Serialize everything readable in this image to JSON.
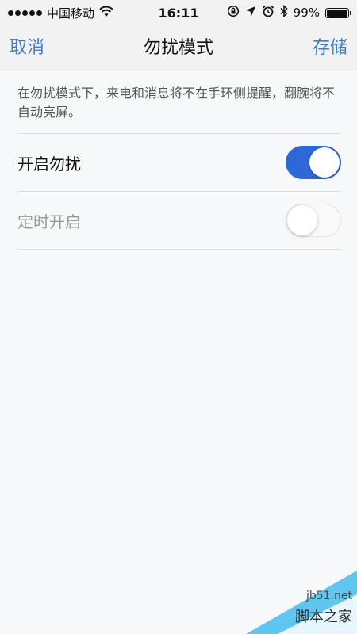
{
  "status_bar": {
    "carrier": "中国移动",
    "time": "16:11",
    "battery_text": "99%",
    "battery_level": 0.99,
    "icons": [
      "signal-dots-icon",
      "wifi-icon",
      "rotation-lock-icon",
      "location-arrow-icon",
      "alarm-icon",
      "bluetooth-icon",
      "battery-icon"
    ]
  },
  "nav": {
    "cancel_label": "取消",
    "title": "勿扰模式",
    "save_label": "存储"
  },
  "description": "在勿扰模式下，来电和消息将不在手环侧提醒，翻腕将不自动亮屏。",
  "settings": [
    {
      "label": "开启勿扰",
      "enabled": true,
      "toggle_on": true
    },
    {
      "label": "定时开启",
      "enabled": false,
      "toggle_on": false
    }
  ],
  "watermark": {
    "site": "jb51.net",
    "name": "脚本之家"
  },
  "colors": {
    "accent": "#3f7ecf",
    "toggle_on": "#2e67d6",
    "background": "#f7f8fa",
    "bar": "#f2f2f2"
  }
}
